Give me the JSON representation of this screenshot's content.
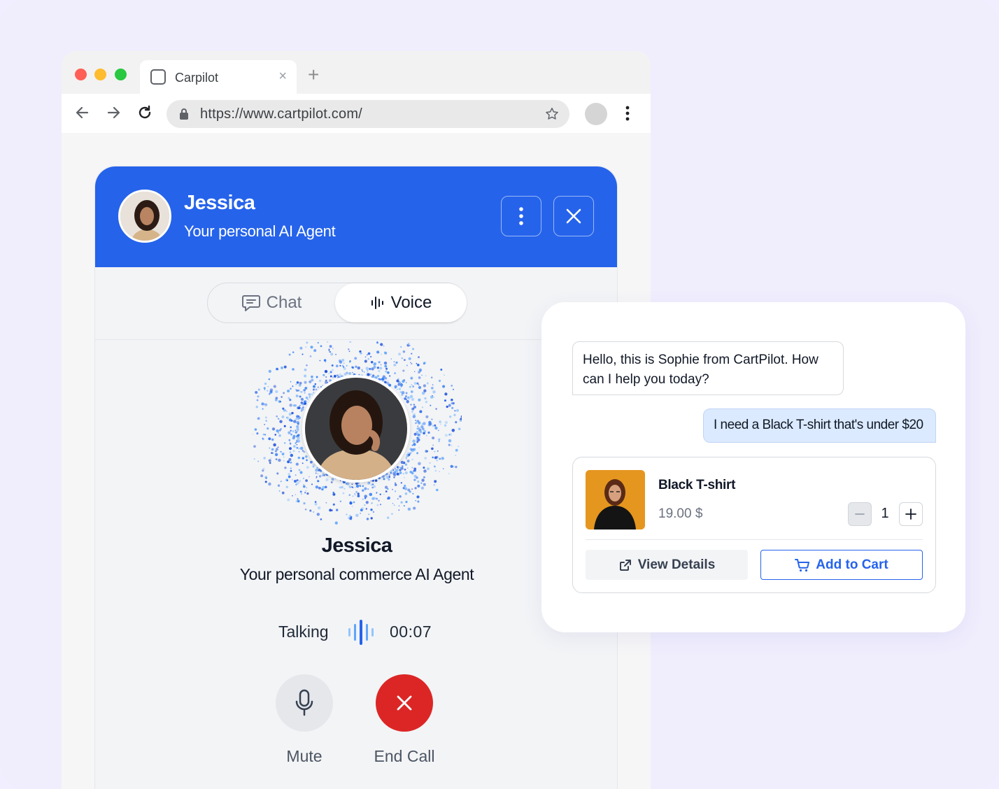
{
  "browser": {
    "tab_title": "Carpilot",
    "tab_close": "×",
    "new_tab": "+",
    "url": "https://www.cartpilot.com/"
  },
  "widget": {
    "header": {
      "name": "Jessica",
      "subtitle": "Your personal AI Agent"
    },
    "tabs": [
      {
        "label": "Chat",
        "icon": "chat-bubble-icon",
        "active": false
      },
      {
        "label": "Voice",
        "icon": "voice-bars-icon",
        "active": true
      }
    ],
    "agent": {
      "name": "Jessica",
      "subtitle": "Your personal  commerce AI Agent"
    },
    "call": {
      "status": "Talking",
      "timer": "00:07"
    },
    "controls": {
      "mute_label": "Mute",
      "end_label": "End Call"
    }
  },
  "chat": {
    "messages": [
      {
        "from": "agent",
        "text": "Hello, this is Sophie from CartPilot. How can I help you today?"
      },
      {
        "from": "user",
        "text": "I need a Black T-shirt that's under $20"
      }
    ],
    "product": {
      "name": "Black T-shirt",
      "price": "19.00 $",
      "quantity": "1",
      "view_details_label": "View Details",
      "add_to_cart_label": "Add to Cart"
    }
  },
  "colors": {
    "primary": "#2563eb",
    "end_call": "#dc2626",
    "background": "#f0eefd"
  }
}
